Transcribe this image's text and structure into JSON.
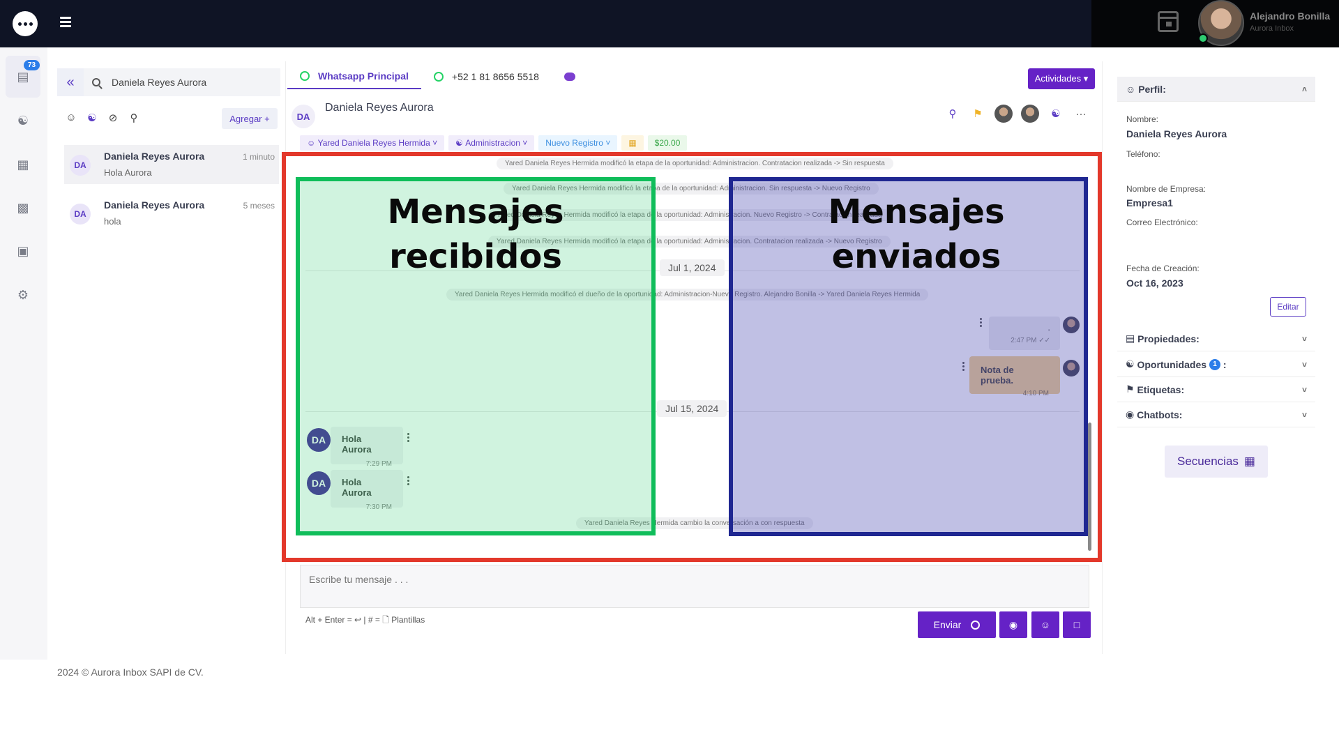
{
  "topbar": {
    "user_name": "Alejandro Bonilla",
    "user_org": "Aurora Inbox",
    "icons": [
      "chat-logo-icon",
      "hamburger-icon",
      "calendar-icon"
    ]
  },
  "rail": {
    "badge": "73",
    "icons": [
      "inbox-icon",
      "contacts-icon",
      "contact-card-icon",
      "monitor-icon",
      "inbox-tray-icon",
      "gear-icon"
    ]
  },
  "list": {
    "search_value": "Daniela Reyes Aurora",
    "add_label": "Agregar +",
    "items": [
      {
        "avatar": "DA",
        "name": "Daniela Reyes Aurora",
        "preview": "Hola Aurora",
        "time": "1 minuto"
      },
      {
        "avatar": "DA",
        "name": "Daniela Reyes Aurora",
        "preview": "hola",
        "time": "5 meses"
      }
    ]
  },
  "tabs": [
    {
      "label": "Whatsapp Principal"
    },
    {
      "label": "+52 1 81 8656 5518"
    }
  ],
  "actividades_label": "Actividades ▾",
  "chat": {
    "avatar": "DA",
    "title": "Daniela Reyes Aurora",
    "pills": {
      "owner": "Yared Daniela Reyes Hermida",
      "team": "Administracion",
      "stage": "Nuevo Registro",
      "amount": "$20.00"
    }
  },
  "messages": {
    "sys1": "Yared Daniela Reyes Hermida modificó la etapa de la oportunidad: Administracion. Contratacion realizada -> Sin respuesta",
    "sys2": "Yared Daniela Reyes Hermida modificó la etapa de la oportunidad: Administracion. Sin respuesta -> Nuevo Registro",
    "sys3": "Yared Daniela Reyes Hermida modificó la etapa de la oportunidad: Administracion. Nuevo Registro -> Contratacion realizada",
    "sys4": "Yared Daniela Reyes Hermida modificó la etapa de la oportunidad: Administracion. Contratacion realizada -> Nuevo Registro",
    "date1": "Jul 1, 2024",
    "sys5": "Yared Daniela Reyes Hermida modificó el dueño de la oportunidad: Administracion-Nuevo Registro. Alejandro Bonilla -> Yared Daniela Reyes Hermida",
    "out1_text": ".",
    "out1_time": "2:47 PM",
    "note_text": "Nota de prueba.",
    "note_time": "4:10 PM",
    "date2": "Jul 15, 2024",
    "in1_text": "Hola Aurora",
    "in1_time": "7:29 PM",
    "in2_text": "Hola Aurora",
    "in2_time": "7:30 PM",
    "sys6": "Yared Daniela Reyes Hermida cambio la conversación a con respuesta"
  },
  "overlay": {
    "received_l1": "Mensajes",
    "received_l2": "recibidos",
    "sent_l1": "Mensajes",
    "sent_l2": "enviados",
    "colors": {
      "frame": "#e3382b",
      "received": "#0fbd5a",
      "sent": "#1f2791"
    }
  },
  "composer": {
    "placeholder": "Escribe tu mensaje . . .",
    "hint": "Alt + Enter = ↩  |  # = 🗋 Plantillas",
    "send_label": "Enviar"
  },
  "profile": {
    "perfil": "Perfil:",
    "nombre_label": "Nombre:",
    "nombre": "Daniela Reyes Aurora",
    "telefono_label": "Teléfono:",
    "empresa_label": "Nombre de Empresa:",
    "empresa": "Empresa1",
    "correo_label": "Correo Electrónico:",
    "creacion_label": "Fecha de Creación:",
    "creacion": "Oct 16, 2023",
    "edit_label": "Editar",
    "propiedades": "Propiedades:",
    "oportunidades": "Oportunidades",
    "oportunidades_count": "1",
    "etiquetas": "Etiquetas:",
    "chatbots": "Chatbots:",
    "secuencias": "Secuencias"
  },
  "footer": "2024 © Aurora Inbox SAPI de CV."
}
